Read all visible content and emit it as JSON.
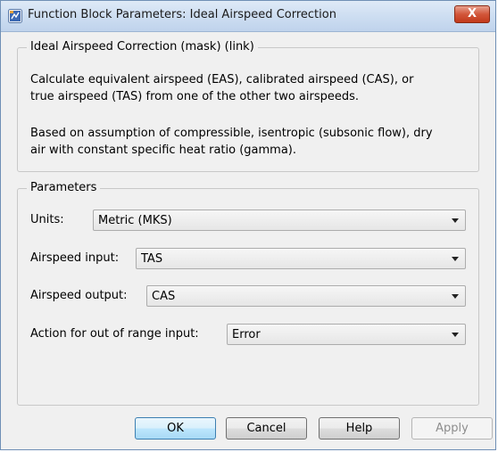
{
  "window": {
    "title": "Function Block Parameters: Ideal Airspeed Correction",
    "close_label": "X"
  },
  "description": {
    "group_title": "Ideal Airspeed Correction (mask) (link)",
    "paragraph1_line1": "Calculate equivalent airspeed (EAS), calibrated airspeed (CAS), or",
    "paragraph1_line2": "true airspeed (TAS) from one of the other two airspeeds.",
    "paragraph2_line1": "Based on assumption of compressible, isentropic (subsonic flow), dry",
    "paragraph2_line2": "air with constant specific heat ratio (gamma)."
  },
  "parameters": {
    "group_title": "Parameters",
    "units": {
      "label": "Units:",
      "value": "Metric (MKS)"
    },
    "airspeed_input": {
      "label": "Airspeed input:",
      "value": "TAS"
    },
    "airspeed_output": {
      "label": "Airspeed output:",
      "value": "CAS"
    },
    "action": {
      "label": "Action for out of range input:",
      "value": "Error"
    }
  },
  "buttons": {
    "ok": "OK",
    "cancel": "Cancel",
    "help": "Help",
    "apply": "Apply"
  },
  "colors": {
    "titlebar": "#cfdff2",
    "close_button": "#c2391b",
    "default_button": "#a7d9f5"
  }
}
